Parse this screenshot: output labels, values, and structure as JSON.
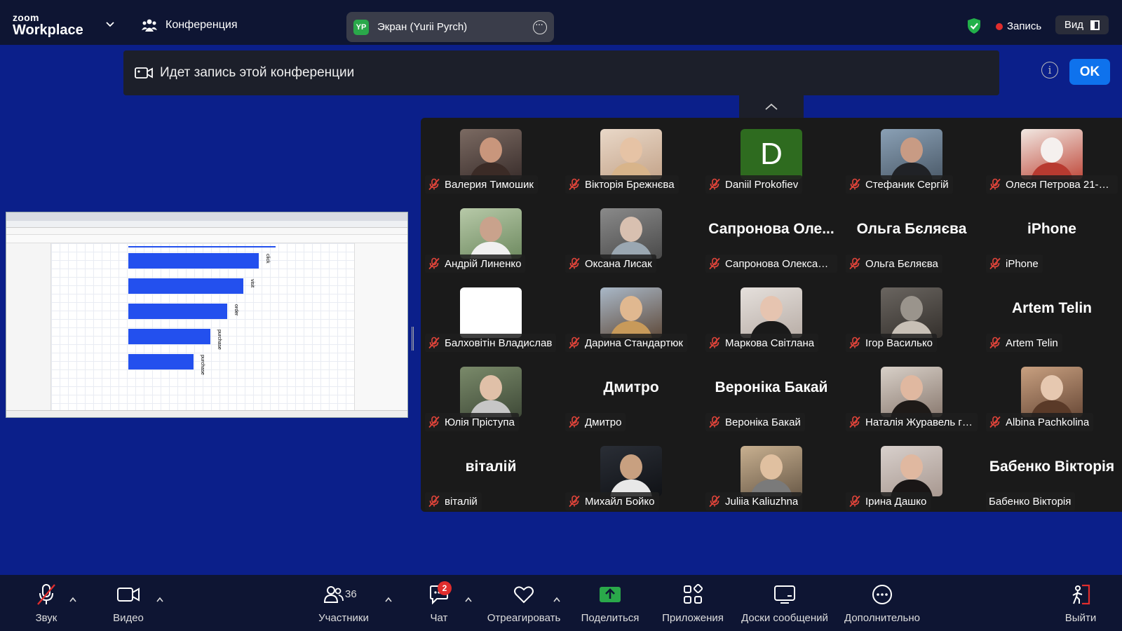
{
  "app": {
    "logo_top": "zoom",
    "logo_bottom": "Workplace"
  },
  "header": {
    "meeting_label": "Конференция",
    "screen_initials": "YP",
    "screen_label": "Экран (Yurii Pyrch)",
    "record_label": "Запись",
    "view_label": "Вид"
  },
  "banner": {
    "text": "Идет запись этой конференции",
    "ok_label": "OK",
    "info": "i"
  },
  "shared_screen": {
    "bars": [
      {
        "label": "click",
        "value": 1.0
      },
      {
        "label": "visit",
        "value": 0.88
      },
      {
        "label": "order",
        "value": 0.76
      },
      {
        "label": "purchase",
        "value": 0.63
      },
      {
        "label": "purchase",
        "value": 0.5
      }
    ]
  },
  "participants": [
    {
      "name": "Валерия Тимошик",
      "kind": "photo",
      "colors": [
        "#7b6a62",
        "#3a2e2c",
        "#c9967c",
        "#3b2b26"
      ]
    },
    {
      "name": "Вікторія Брежнєва",
      "kind": "photo",
      "colors": [
        "#e9d8c8",
        "#c4a48a",
        "#e6c3a5",
        "#d8b48a"
      ]
    },
    {
      "name": "Daniil Prokofiev",
      "kind": "initial",
      "initial": "D"
    },
    {
      "name": "Стефаник Сергій",
      "kind": "photo",
      "colors": [
        "#8aa0b5",
        "#4c5b6a",
        "#c89b84",
        "#202226"
      ]
    },
    {
      "name": "Олеся Петрова 21-ЕМ",
      "kind": "photo",
      "colors": [
        "#f1e8e2",
        "#c04a3c",
        "#f5f0ee",
        "#b83a30"
      ]
    },
    {
      "name": "Андрій Линенко",
      "kind": "photo",
      "colors": [
        "#b7c9a8",
        "#6e8a60",
        "#c9a28c",
        "#f0f0f0"
      ]
    },
    {
      "name": "Оксана Лисак",
      "kind": "photo",
      "colors": [
        "#8a8a8a",
        "#4a4a4a",
        "#d8c0b0",
        "#9aa7b2"
      ]
    },
    {
      "name": "Сапронова Олександ...",
      "kind": "text",
      "big": "Сапронова Оле..."
    },
    {
      "name": "Ольга Бєляєва",
      "kind": "text",
      "big": "Ольга Бєляєва"
    },
    {
      "name": "iPhone",
      "kind": "text",
      "big": "iPhone"
    },
    {
      "name": "Балховітін Владислав",
      "kind": "blank"
    },
    {
      "name": "Дарина Стандартюк",
      "kind": "photo",
      "colors": [
        "#a9b8c8",
        "#5f4a3a",
        "#e0b890",
        "#c89a5a"
      ]
    },
    {
      "name": "Маркова Світлана",
      "kind": "photo",
      "colors": [
        "#e5e0dc",
        "#b8ada6",
        "#e6c4b0",
        "#1a1a1a"
      ]
    },
    {
      "name": "Ігор Василько",
      "kind": "photo",
      "colors": [
        "#6a6560",
        "#34302c",
        "#9a948c",
        "#c8c0b6"
      ]
    },
    {
      "name": "Artem Telin",
      "kind": "text",
      "big": "Artem Telin"
    },
    {
      "name": "Юлія Пріступа",
      "kind": "photo",
      "colors": [
        "#7a8a6a",
        "#3f4a38",
        "#e0c0a8",
        "#c6c6c6"
      ]
    },
    {
      "name": "Дмитро",
      "kind": "text",
      "big": "Дмитро"
    },
    {
      "name": "Вероніка Бакай",
      "kind": "text",
      "big": "Вероніка Бакай"
    },
    {
      "name": "Наталія Журавель гр ...",
      "kind": "photo",
      "colors": [
        "#d8d0c8",
        "#8a7a70",
        "#e0b8a0",
        "#1e1a18"
      ]
    },
    {
      "name": "Albina Pachkolina",
      "kind": "photo",
      "colors": [
        "#c8a080",
        "#6a4a38",
        "#e6c8b0",
        "#5a3a28"
      ]
    },
    {
      "name": "віталій",
      "kind": "text",
      "big": "віталій"
    },
    {
      "name": "Михайл Бойко",
      "kind": "photo",
      "colors": [
        "#2a2e36",
        "#101216",
        "#c8a080",
        "#e8e8e8"
      ]
    },
    {
      "name": "Juliia Kaliuzhna",
      "kind": "photo",
      "colors": [
        "#c8b090",
        "#6a5a48",
        "#e0c0a0",
        "#7a7a7a"
      ]
    },
    {
      "name": "Ірина Дашко",
      "kind": "photo",
      "colors": [
        "#d8d0cc",
        "#a89890",
        "#e0b8a0",
        "#1a1616"
      ]
    },
    {
      "name": "Бабенко Вікторія",
      "kind": "text",
      "big": "Бабенко Вікторія",
      "muted": false
    }
  ],
  "toolbar": {
    "audio_label": "Звук",
    "video_label": "Видео",
    "participants_label": "Участники",
    "participants_count": "36",
    "chat_label": "Чат",
    "chat_badge": "2",
    "react_label": "Отреагировать",
    "share_label": "Поделиться",
    "apps_label": "Приложения",
    "whiteboards_label": "Доски сообщений",
    "more_label": "Дополнительно",
    "leave_label": "Выйти"
  },
  "colors": {
    "background": "#0b1f8a",
    "bar": "#0e1533",
    "accent": "#0e72ed",
    "share": "#2aa84a",
    "recording": "#e02d2d"
  }
}
